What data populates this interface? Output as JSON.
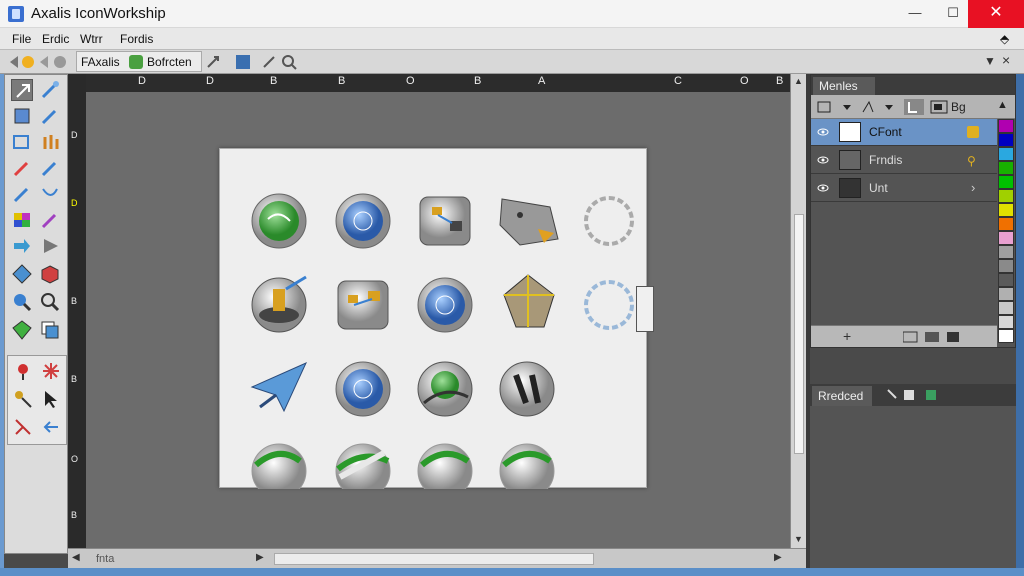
{
  "window": {
    "title": "Axalis IconWorkship",
    "minimize": "—",
    "maximize": "☐",
    "close": "✕"
  },
  "menu": {
    "items": [
      "File",
      "Erdic",
      "Wtrr",
      "Fordis"
    ],
    "right_icon": "⬘"
  },
  "toolbar": {
    "doc_tabs": [
      "FAxalis",
      "Bofrcten"
    ],
    "dropdown_arrow": "▼",
    "close": "×"
  },
  "ruler": {
    "labels": [
      "D",
      "D",
      "B",
      "B",
      "O",
      "B",
      "A",
      "C",
      "O",
      "B"
    ]
  },
  "layers_panel": {
    "tab": "Menles",
    "tool_label": "Bg",
    "layers": [
      {
        "name": "CFont",
        "active": true
      },
      {
        "name": "Frndis",
        "active": false
      },
      {
        "name": "Unt",
        "active": false
      }
    ],
    "swatches": [
      "#b000b0",
      "#0000c0",
      "#2aa8e0",
      "#18b000",
      "#00c000",
      "#a0d000",
      "#e0e000",
      "#f07000",
      "#e8a0d0",
      "#a0a0a0",
      "#8a8a8a",
      "#5a5a5a",
      "#b0b0b0",
      "#c8c8c8",
      "#d8d8d8",
      "#ffffff"
    ]
  },
  "second_panel": {
    "tab": "Rredced"
  },
  "scrollbar": {
    "h_label": "fnta"
  },
  "icons": [
    [
      "green-globe-icon",
      "blue-globe-icon",
      "document-flow-icon",
      "scroll-icon",
      "empty-circle-icon"
    ],
    [
      "hammer-icon",
      "document-flow-icon",
      "blue-globe-icon",
      "pyramid-icon",
      "empty-circle-icon"
    ],
    [
      "airplane-icon",
      "blue-globe-icon",
      "green-arrow-globe-icon",
      "dark-tools-icon",
      ""
    ],
    [
      "green-circle-icon",
      "green-link-icon",
      "green-circle-icon",
      "green-circle-icon",
      ""
    ]
  ],
  "colors": {
    "accent": "#6a93c6",
    "canvas": "#6c6c6c"
  }
}
